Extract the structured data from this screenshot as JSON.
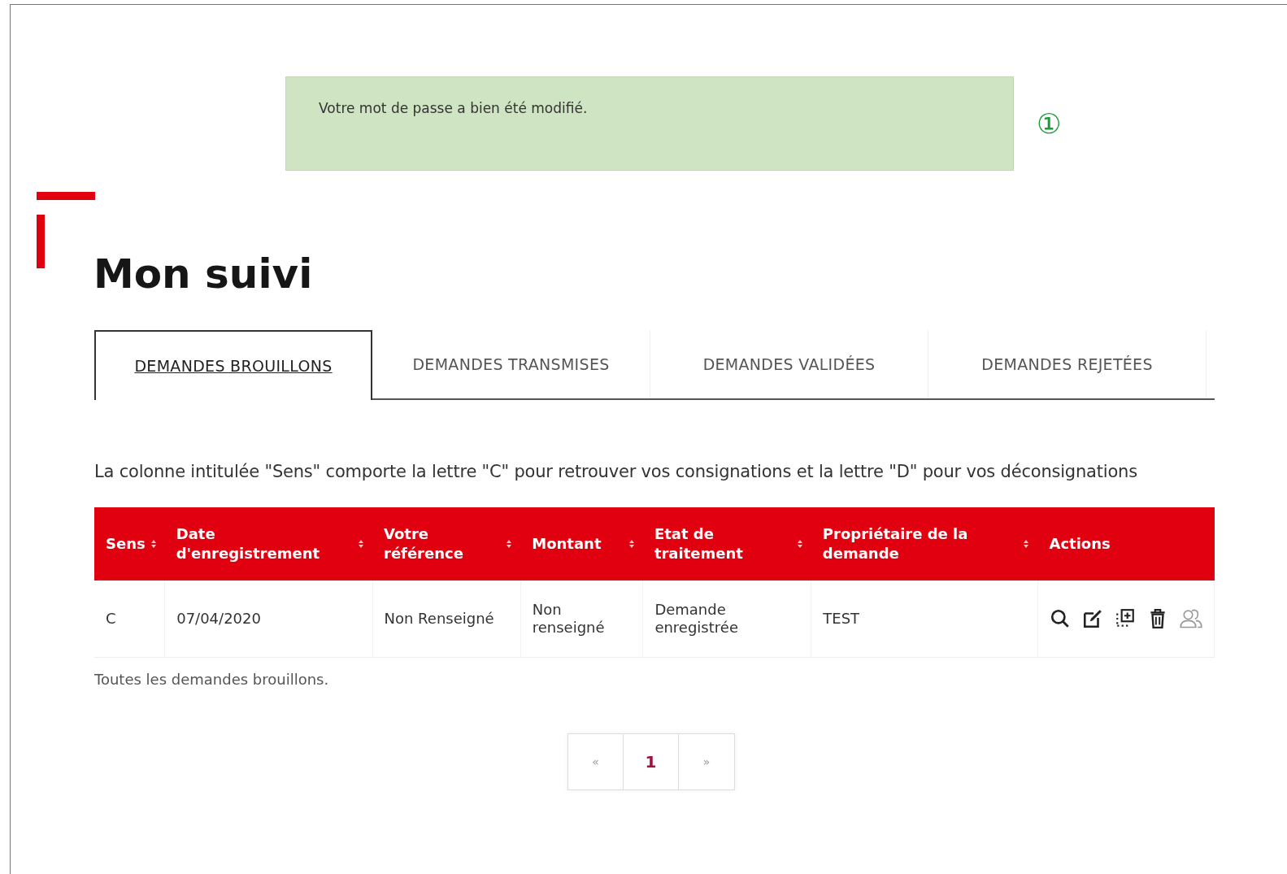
{
  "notification": {
    "message": "Votre mot de passe a bien été modifié.",
    "marker": "①"
  },
  "page_title": "Mon suivi",
  "tabs": [
    {
      "label": "DEMANDES BROUILLONS",
      "selected": true
    },
    {
      "label": "DEMANDES TRANSMISES",
      "selected": false
    },
    {
      "label": "DEMANDES VALIDÉES",
      "selected": false
    },
    {
      "label": "DEMANDES REJETÉES",
      "selected": false
    }
  ],
  "info_text": "La colonne intitulée \"Sens\" comporte la lettre \"C\" pour retrouver vos consignations et la lettre \"D\" pour vos déconsignations",
  "table": {
    "columns": [
      {
        "label": "Sens",
        "sortable": true
      },
      {
        "label": "Date d'enregistrement",
        "sortable": true
      },
      {
        "label": "Votre référence",
        "sortable": true
      },
      {
        "label": "Montant",
        "sortable": true
      },
      {
        "label": "Etat de traitement",
        "sortable": true
      },
      {
        "label": "Propriétaire de la demande",
        "sortable": true
      },
      {
        "label": "Actions",
        "sortable": false
      }
    ],
    "rows": [
      {
        "cells": [
          "C",
          "07/04/2020",
          "Non Renseigné",
          "Non renseigné",
          "Demande enregistrée",
          "TEST"
        ],
        "actions": [
          {
            "kind": "view"
          },
          {
            "kind": "edit"
          },
          {
            "kind": "duplicate"
          },
          {
            "kind": "delete"
          },
          {
            "kind": "owner"
          }
        ]
      }
    ],
    "caption": "Toutes les demandes brouillons."
  },
  "pagination": {
    "previous": "«",
    "next": "»",
    "pages": [
      {
        "label": "1",
        "selected": true
      }
    ]
  }
}
